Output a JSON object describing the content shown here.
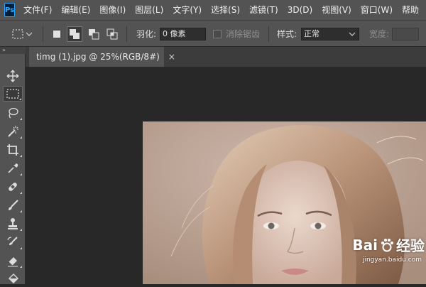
{
  "app": {
    "logo_text": "Ps"
  },
  "menu": {
    "items": [
      "文件(F)",
      "编辑(E)",
      "图像(I)",
      "图层(L)",
      "文字(Y)",
      "选择(S)",
      "滤镜(T)",
      "3D(D)",
      "视图(V)",
      "窗口(W)",
      "帮助"
    ]
  },
  "options": {
    "feather_label": "羽化:",
    "feather_value": "0 像素",
    "antialias_label": "消除锯齿",
    "style_label": "样式:",
    "style_value": "正常",
    "width_label": "宽度:"
  },
  "panel_collapse_glyph": "»",
  "document": {
    "tab_title": "timg (1).jpg @ 25%(RGB/8#)",
    "close_glyph": "×"
  },
  "watermark": {
    "brand_left": "Bai",
    "brand_right": "经验",
    "url": "jingyan.baidu.com"
  },
  "colors": {
    "menubar": "#535353",
    "canvas": "#282828",
    "logo_bg": "#001d34",
    "logo_fg": "#31a8ff"
  },
  "tools": [
    "move-icon",
    "rectangular-marquee-icon",
    "lasso-icon",
    "magic-wand-icon",
    "crop-icon",
    "eyedropper-icon",
    "healing-brush-icon",
    "brush-icon",
    "clone-stamp-icon",
    "history-brush-icon",
    "eraser-icon",
    "paint-bucket-icon"
  ]
}
